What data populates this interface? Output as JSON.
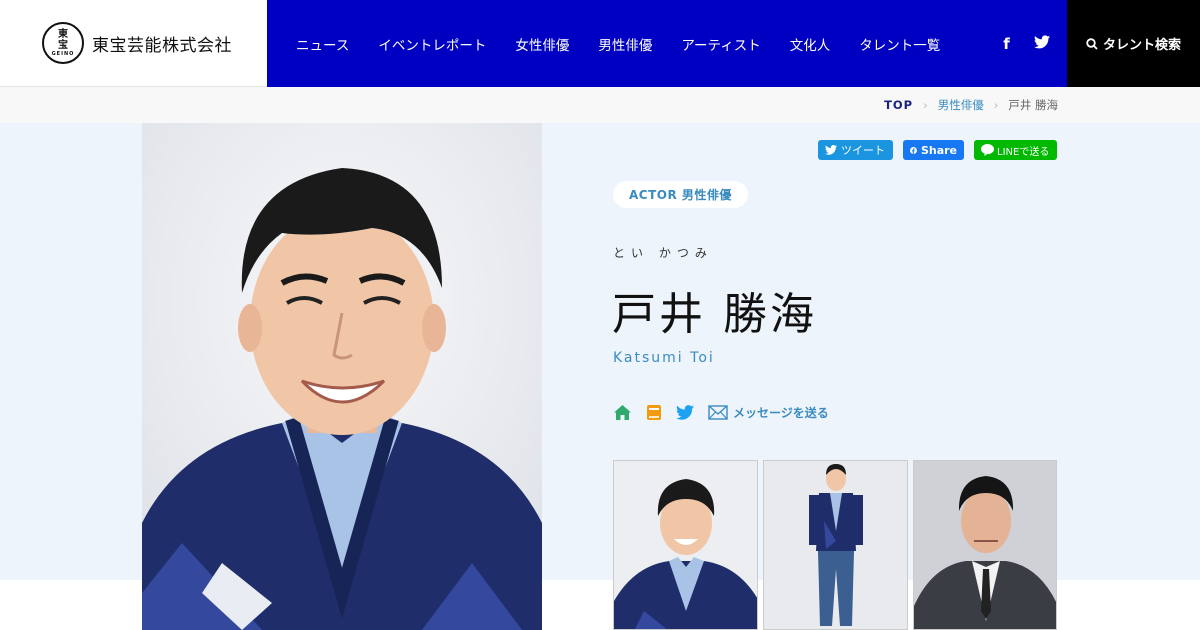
{
  "header": {
    "logo": {
      "seal_top": "東",
      "seal_bottom": "宝",
      "seal_sub": "GEINO",
      "company": "東宝芸能株式会社"
    },
    "nav": [
      "ニュース",
      "イベントレポート",
      "女性俳優",
      "男性俳優",
      "アーティスト",
      "文化人",
      "タレント一覧"
    ],
    "social": {
      "facebook": "f",
      "twitter_icon": "twitter-icon"
    },
    "search_label": "タレント検索"
  },
  "breadcrumb": {
    "top": "TOP",
    "category": "男性俳優",
    "current": "戸井 勝海"
  },
  "share": {
    "tweet": "ツイート",
    "facebook": "Share",
    "line": "LINEで送る"
  },
  "profile": {
    "badge": "ACTOR 男性俳優",
    "furigana": "とい かつみ",
    "name_jp": "戸井 勝海",
    "name_en": "Katsumi Toi",
    "message_label": "メッセージを送る"
  },
  "colors": {
    "nav_bg": "#0000c2",
    "accent": "#3a8bbf",
    "content_bg": "#eef4fc",
    "search_bg": "#000000"
  },
  "icons": [
    "home-icon",
    "book-icon",
    "twitter-icon",
    "mail-icon",
    "search-icon",
    "facebook-icon",
    "line-icon"
  ]
}
